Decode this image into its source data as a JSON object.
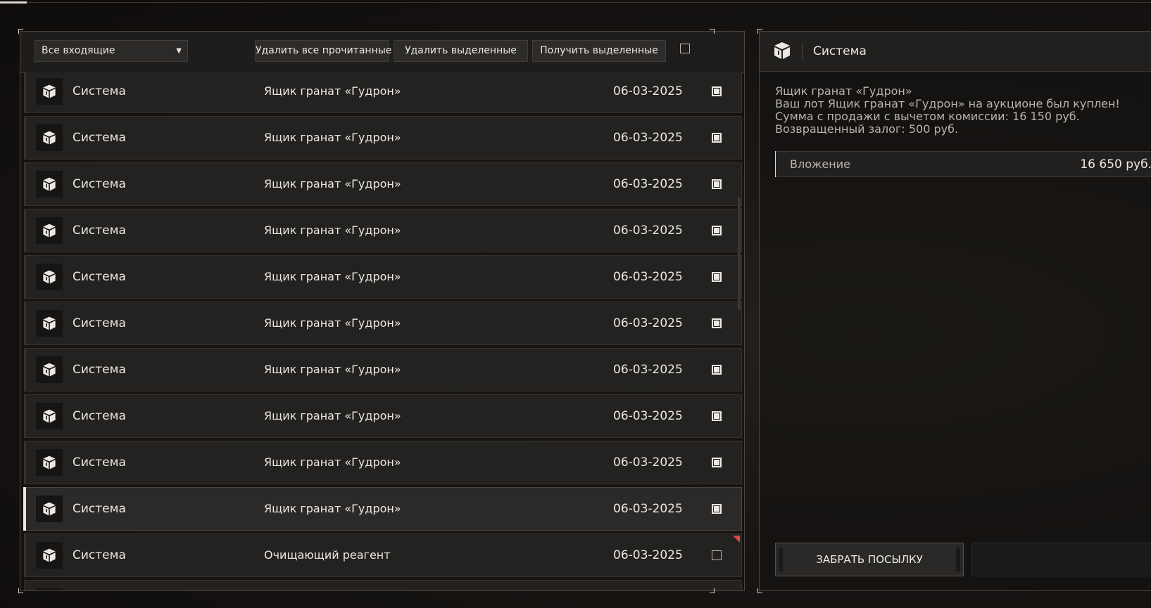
{
  "toolbar": {
    "filter_value": "Все входящие",
    "delete_read_label": "Удалить все прочитанные",
    "delete_selected_label": "Удалить выделенные",
    "receive_selected_label": "Получить выделенные"
  },
  "mail_list": [
    {
      "sender": "Система",
      "subject": "Ящик гранат «Гудрон»",
      "date": "06-03-2025",
      "checked": true,
      "selected": false,
      "new": false
    },
    {
      "sender": "Система",
      "subject": "Ящик гранат «Гудрон»",
      "date": "06-03-2025",
      "checked": true,
      "selected": false,
      "new": false
    },
    {
      "sender": "Система",
      "subject": "Ящик гранат «Гудрон»",
      "date": "06-03-2025",
      "checked": true,
      "selected": false,
      "new": false
    },
    {
      "sender": "Система",
      "subject": "Ящик гранат «Гудрон»",
      "date": "06-03-2025",
      "checked": true,
      "selected": false,
      "new": false
    },
    {
      "sender": "Система",
      "subject": "Ящик гранат «Гудрон»",
      "date": "06-03-2025",
      "checked": true,
      "selected": false,
      "new": false
    },
    {
      "sender": "Система",
      "subject": "Ящик гранат «Гудрон»",
      "date": "06-03-2025",
      "checked": true,
      "selected": false,
      "new": false
    },
    {
      "sender": "Система",
      "subject": "Ящик гранат «Гудрон»",
      "date": "06-03-2025",
      "checked": true,
      "selected": false,
      "new": false
    },
    {
      "sender": "Система",
      "subject": "Ящик гранат «Гудрон»",
      "date": "06-03-2025",
      "checked": true,
      "selected": false,
      "new": false
    },
    {
      "sender": "Система",
      "subject": "Ящик гранат «Гудрон»",
      "date": "06-03-2025",
      "checked": true,
      "selected": false,
      "new": false
    },
    {
      "sender": "Система",
      "subject": "Ящик гранат «Гудрон»",
      "date": "06-03-2025",
      "checked": true,
      "selected": true,
      "new": false
    },
    {
      "sender": "Система",
      "subject": "Очищающий реагент",
      "date": "06-03-2025",
      "checked": false,
      "selected": false,
      "new": true
    }
  ],
  "detail": {
    "sender": "Система",
    "subject_line": "Ящик гранат «Гудрон»",
    "body_lines": [
      "Ваш лот Ящик гранат «Гудрон» на аукционе был куплен!",
      "Сумма с продажи с вычетом комиссии: 16 150 руб.",
      "Возвращенный залог: 500 руб."
    ],
    "attachment_label": "Вложение",
    "attachment_value": "16 650 руб.",
    "take_button_label": "ЗАБРАТЬ ПОСЫЛКУ"
  },
  "colors": {
    "new_flag": "#e04a44",
    "text_primary": "#ebe8e4",
    "text_secondary": "#b8b4af"
  },
  "icons": {
    "mail_sender_icon": "box-icon",
    "filter_dropdown_icon": "triangle-down-icon"
  }
}
